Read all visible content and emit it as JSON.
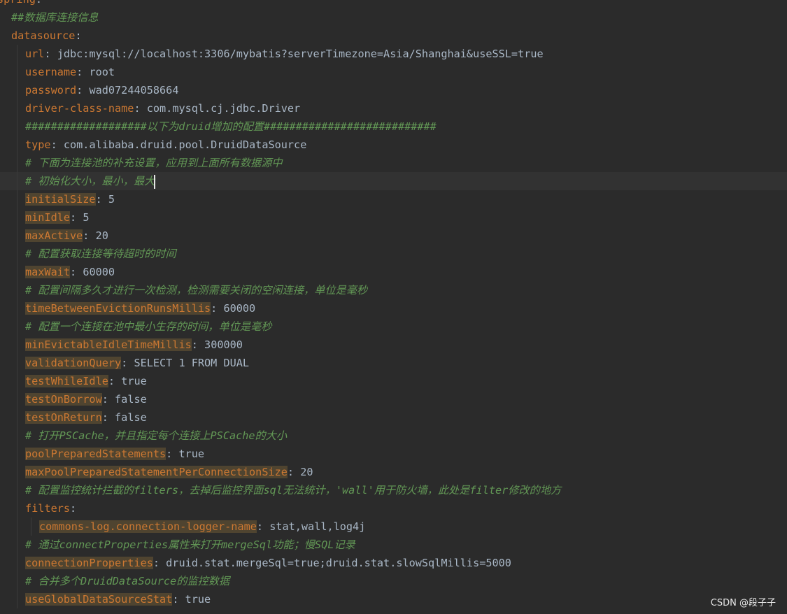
{
  "code": {
    "lines": [
      {
        "indent": 0,
        "key": "spring",
        "sep": ":",
        "value": ""
      },
      {
        "indent": 1,
        "comment": "##数据库连接信息"
      },
      {
        "indent": 1,
        "key": "datasource",
        "sep": ":",
        "value": ""
      },
      {
        "indent": 2,
        "key": "url",
        "sep": ": ",
        "value": "jdbc:mysql://localhost:3306/mybatis?serverTimezone=Asia/Shanghai&useSSL=true"
      },
      {
        "indent": 2,
        "key": "username",
        "sep": ": ",
        "value": "root"
      },
      {
        "indent": 2,
        "key": "password",
        "sep": ": ",
        "value": "wad07244058664"
      },
      {
        "indent": 2,
        "key": "driver-class-name",
        "sep": ": ",
        "value": "com.mysql.cj.jdbc.Driver"
      },
      {
        "indent": 2,
        "comment": "###################以下为druid增加的配置###########################"
      },
      {
        "indent": 2,
        "key": "type",
        "sep": ": ",
        "value": "com.alibaba.druid.pool.DruidDataSource"
      },
      {
        "indent": 2,
        "comment": "# 下面为连接池的补充设置，应用到上面所有数据源中"
      },
      {
        "indent": 2,
        "comment": "# 初始化大小，最小，最大",
        "current": true,
        "caret": true
      },
      {
        "indent": 2,
        "key": "initialSize",
        "sep": ": ",
        "value": "5",
        "hl": true
      },
      {
        "indent": 2,
        "key": "minIdle",
        "sep": ": ",
        "value": "5",
        "hl": true
      },
      {
        "indent": 2,
        "key": "maxActive",
        "sep": ": ",
        "value": "20",
        "hl": true
      },
      {
        "indent": 2,
        "comment": "# 配置获取连接等待超时的时间"
      },
      {
        "indent": 2,
        "key": "maxWait",
        "sep": ": ",
        "value": "60000",
        "hl": true
      },
      {
        "indent": 2,
        "comment": "# 配置间隔多久才进行一次检测，检测需要关闭的空闲连接，单位是毫秒"
      },
      {
        "indent": 2,
        "key": "timeBetweenEvictionRunsMillis",
        "sep": ": ",
        "value": "60000",
        "hl": true
      },
      {
        "indent": 2,
        "comment": "# 配置一个连接在池中最小生存的时间，单位是毫秒"
      },
      {
        "indent": 2,
        "key": "minEvictableIdleTimeMillis",
        "sep": ": ",
        "value": "300000",
        "hl": true
      },
      {
        "indent": 2,
        "key": "validationQuery",
        "sep": ": ",
        "value": "SELECT 1 FROM DUAL",
        "hl": true
      },
      {
        "indent": 2,
        "key": "testWhileIdle",
        "sep": ": ",
        "value": "true",
        "hl": true
      },
      {
        "indent": 2,
        "key": "testOnBorrow",
        "sep": ": ",
        "value": "false",
        "hl": true
      },
      {
        "indent": 2,
        "key": "testOnReturn",
        "sep": ": ",
        "value": "false",
        "hl": true
      },
      {
        "indent": 2,
        "comment": "# 打开PSCache，并且指定每个连接上PSCache的大小"
      },
      {
        "indent": 2,
        "key": "poolPreparedStatements",
        "sep": ": ",
        "value": "true",
        "hl": true
      },
      {
        "indent": 2,
        "key": "maxPoolPreparedStatementPerConnectionSize",
        "sep": ": ",
        "value": "20",
        "hl": true
      },
      {
        "indent": 2,
        "comment": "# 配置监控统计拦截的filters，去掉后监控界面sql无法统计，'wall'用于防火墙，此处是filter修改的地方"
      },
      {
        "indent": 2,
        "key": "filters",
        "sep": ":",
        "value": ""
      },
      {
        "indent": 3,
        "key": "commons-log.connection-logger-name",
        "sep": ": ",
        "value": "stat,wall,log4j",
        "hl": true
      },
      {
        "indent": 2,
        "comment": "# 通过connectProperties属性来打开mergeSql功能；慢SQL记录"
      },
      {
        "indent": 2,
        "key": "connectionProperties",
        "sep": ": ",
        "value": "druid.stat.mergeSql=true;druid.stat.slowSqlMillis=5000",
        "hl": true
      },
      {
        "indent": 2,
        "comment": "# 合并多个DruidDataSource的监控数据"
      },
      {
        "indent": 2,
        "key": "useGlobalDataSourceStat",
        "sep": ": ",
        "value": "true",
        "hl": true
      }
    ]
  },
  "watermark": "CSDN @段子子",
  "colors": {
    "background": "#2b2b2b",
    "key": "#cc7832",
    "key_highlight": "#4f4430",
    "value": "#a9b7c6",
    "comment": "#629755",
    "current_line": "#323232"
  }
}
